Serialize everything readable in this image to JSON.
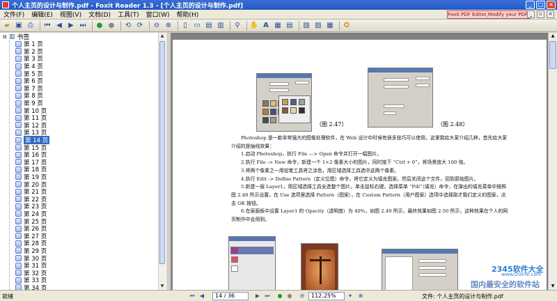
{
  "window": {
    "title": "个人主页的设计与制作.pdf - Foxit Reader 1.3 - [个人主页的设计与制作.pdf]"
  },
  "menu": {
    "items": [
      "文件(F)",
      "编辑(E)",
      "视图(V)",
      "文档(D)",
      "工具(T)",
      "窗口(W)",
      "帮助(H)"
    ],
    "promo": "Foxit PDF Editor,Modify your PDF!"
  },
  "sidebar": {
    "root_label": "书签",
    "pages": [
      "第 1 页",
      "第 2 页",
      "第 3 页",
      "第 4 页",
      "第 5 页",
      "第 6 页",
      "第 7 页",
      "第 8 页",
      "第 9 页",
      "第 10 页",
      "第 11 页",
      "第 12 页",
      "第 13 页",
      "第 14 页",
      "第 15 页",
      "第 16 页",
      "第 17 页",
      "第 18 页",
      "第 19 页",
      "第 20 页",
      "第 21 页",
      "第 22 页",
      "第 23 页",
      "第 24 页",
      "第 25 页",
      "第 26 页",
      "第 27 页",
      "第 28 页",
      "第 29 页",
      "第 30 页",
      "第 31 页",
      "第 32 页",
      "第 33 页",
      "第 34 页"
    ],
    "selected_index": 13
  },
  "document": {
    "caption_1": "（图 2.47）",
    "caption_2": "（图 2.48）",
    "paragraphs": [
      "Photoshop 是一款非常强大的图像处理软件，在 Web 设计中时候有很多技巧可以使用，这里我给大家介绍几种，首先给大家介绍的是抽线效果：",
      "1.启动 Photoshop，执行 File —> Open 命令并打开一幅图片。",
      "2.执行 File -> New 命令，新建一个 1×2 像素大小的图片，同时按下 “Ctrl + 0”，将场景放大 100 倍。",
      "3.将两个像素之一用铅笔工具将之涂色，用区域选择工具选中这两个像素。",
      "4.执行 Edit -> Define Pattern（定义位图）命令，将它定义为填充图案。然后关闭这个文件，回到原始图片。",
      "5.新建一层 Layer1，用区域选择工具全选整个图片，单击鼠标右键，选择菜单 “Fill”（填充）命令，在弹出的填充菜单中按照图 2.48 所示设置，在 Use 选项里选择 Pattern（图案），在 Custom Pattern（用户图案）选项中选择刚才我们定义的图案，点击 OK 按钮。",
      "6.在层面板中设置 Layer1 的 Opacity（透明度）为 40%，如图 2.49 所示，最终效果如图 2.50 所示，这种效果在个人的网页制作中会用到。"
    ]
  },
  "status": {
    "text": "就绪",
    "page": "14 / 36",
    "zoom": "112.25%",
    "filename": "文件: 个人主页的设计与制作.pdf"
  },
  "watermark": {
    "logo": "2345软件大全",
    "url": "www.DuoTe.com",
    "text": "国内最安全的软件站"
  }
}
